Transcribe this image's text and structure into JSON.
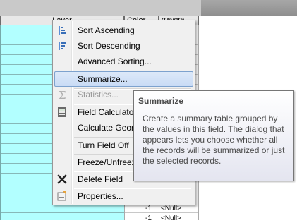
{
  "table": {
    "headers": {
      "layer": "Layer",
      "color": "Color",
      "gwygre": "gwygre"
    },
    "rows": [
      {
        "color": "-1",
        "gwygre": "<Null>"
      },
      {
        "color": "-1",
        "gwygre": "<Null>"
      }
    ]
  },
  "context_menu": {
    "items": [
      {
        "label": "Sort Ascending",
        "icon": "sort-ascending-icon",
        "enabled": true
      },
      {
        "label": "Sort Descending",
        "icon": "sort-descending-icon",
        "enabled": true
      },
      {
        "label": "Advanced Sorting...",
        "icon": "",
        "enabled": true
      },
      {
        "label": "Summarize...",
        "icon": "",
        "enabled": true,
        "highlighted": true
      },
      {
        "label": "Statistics...",
        "icon": "sigma-icon",
        "enabled": false
      },
      {
        "label": "Field Calculator...",
        "icon": "calculator-icon",
        "enabled": true
      },
      {
        "label": "Calculate Geometry...",
        "icon": "",
        "enabled": true
      },
      {
        "label": "Turn Field Off",
        "icon": "",
        "enabled": true
      },
      {
        "label": "Freeze/Unfreeze Column",
        "icon": "",
        "enabled": true
      },
      {
        "label": "Delete Field",
        "icon": "delete-x-icon",
        "enabled": true
      },
      {
        "label": "Properties...",
        "icon": "properties-icon",
        "enabled": true
      }
    ]
  },
  "tooltip": {
    "title": "Summarize",
    "body": "Create a summary table grouped by the values in this field. The dialog that appears lets you choose whether all the records will be summarized or just the selected records."
  },
  "colors": {
    "highlight": "#c9dbf5",
    "table_selected": "#b2ffff"
  }
}
